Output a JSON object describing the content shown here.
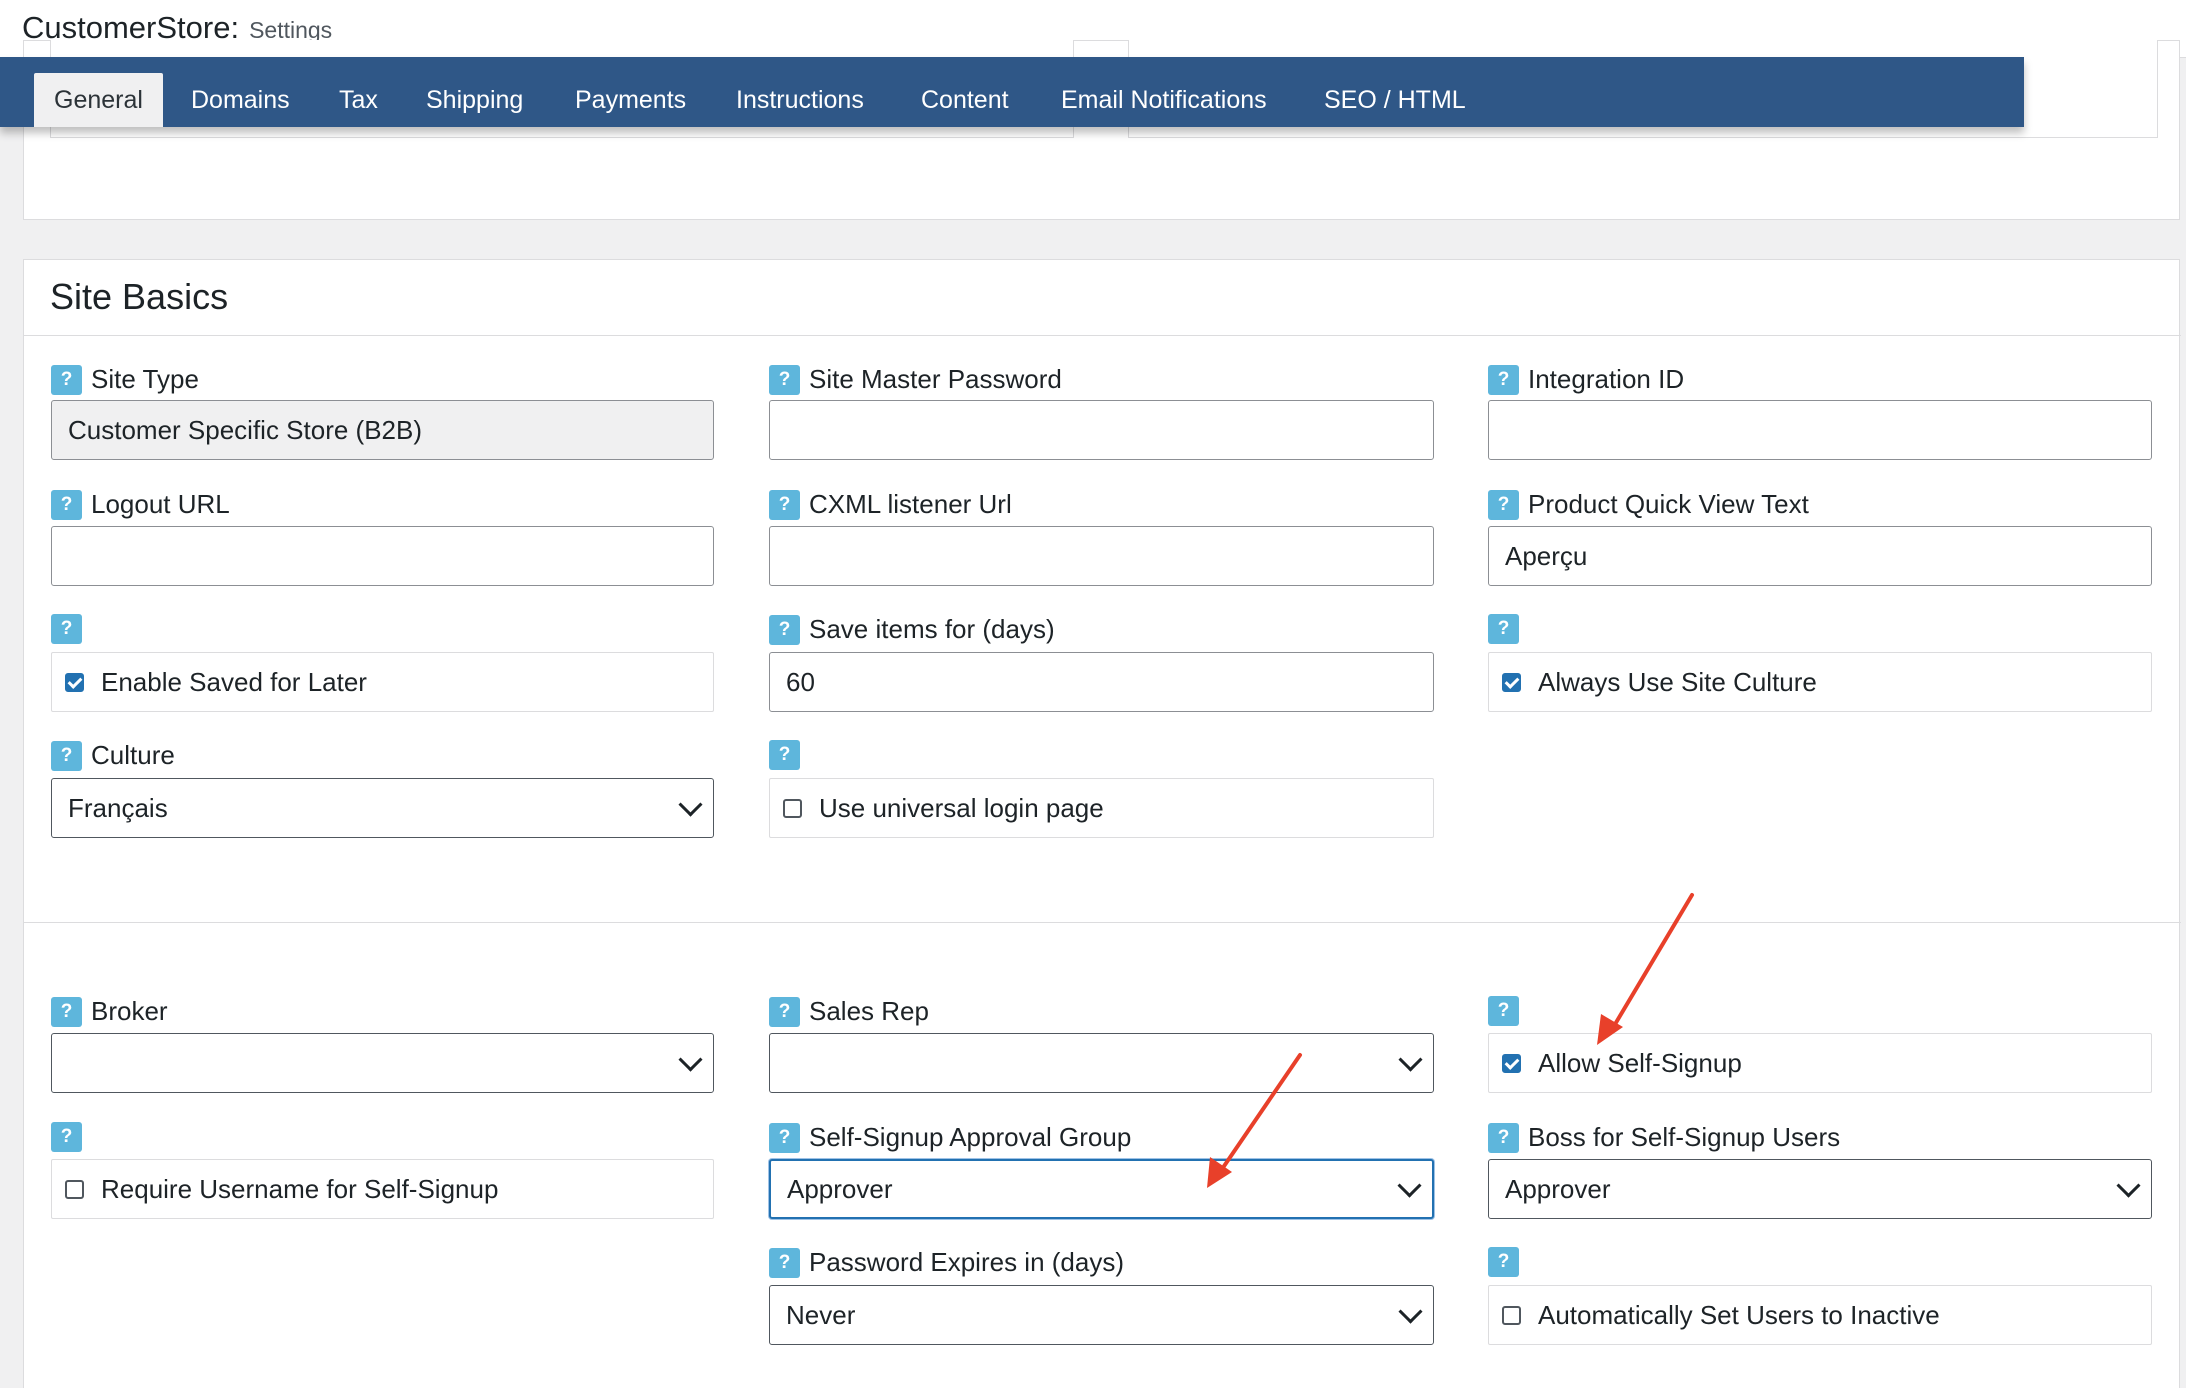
{
  "header": {
    "app_name": "CustomerStore:",
    "page": "Settings"
  },
  "tabs": [
    {
      "label": "General",
      "active": true
    },
    {
      "label": "Domains"
    },
    {
      "label": "Tax"
    },
    {
      "label": "Shipping"
    },
    {
      "label": "Payments"
    },
    {
      "label": "Instructions"
    },
    {
      "label": "Content"
    },
    {
      "label": "Email Notifications"
    },
    {
      "label": "SEO / HTML"
    }
  ],
  "help_glyph": "?",
  "section": {
    "title": "Site Basics"
  },
  "fields": {
    "site_type": {
      "label": "Site Type",
      "value": "Customer Specific Store (B2B)"
    },
    "site_master_password": {
      "label": "Site Master Password",
      "value": ""
    },
    "integration_id": {
      "label": "Integration ID",
      "value": ""
    },
    "logout_url": {
      "label": "Logout URL",
      "value": ""
    },
    "cxml_listener_url": {
      "label": "CXML listener Url",
      "value": ""
    },
    "product_quick_view_text": {
      "label": "Product Quick View Text",
      "value": "Aperçu"
    },
    "enable_saved_for_later": {
      "label": "Enable Saved for Later",
      "checked": true
    },
    "save_items_for": {
      "label": "Save items for (days)",
      "value": "60"
    },
    "always_use_site_culture": {
      "label": "Always Use Site Culture",
      "checked": true
    },
    "culture": {
      "label": "Culture",
      "value": "Français"
    },
    "use_universal_login": {
      "label": "Use universal login page",
      "checked": false
    },
    "broker": {
      "label": "Broker",
      "value": ""
    },
    "sales_rep": {
      "label": "Sales Rep",
      "value": ""
    },
    "allow_self_signup": {
      "label": "Allow Self-Signup",
      "checked": true
    },
    "require_username": {
      "label": "Require Username for Self-Signup",
      "checked": false
    },
    "approval_group": {
      "label": "Self-Signup Approval Group",
      "value": "Approver"
    },
    "boss_for_self_signup": {
      "label": "Boss for Self-Signup Users",
      "value": "Approver"
    },
    "password_expires": {
      "label": "Password Expires in (days)",
      "value": "Never"
    },
    "auto_set_inactive": {
      "label": "Automatically Set Users to Inactive",
      "checked": false
    }
  },
  "colors": {
    "nav_bg": "#2f5787",
    "help_badge": "#5eb6dc",
    "checkbox_checked": "#2271b1",
    "focus_border": "#2271b1",
    "annotation_arrow": "#e8402a"
  }
}
